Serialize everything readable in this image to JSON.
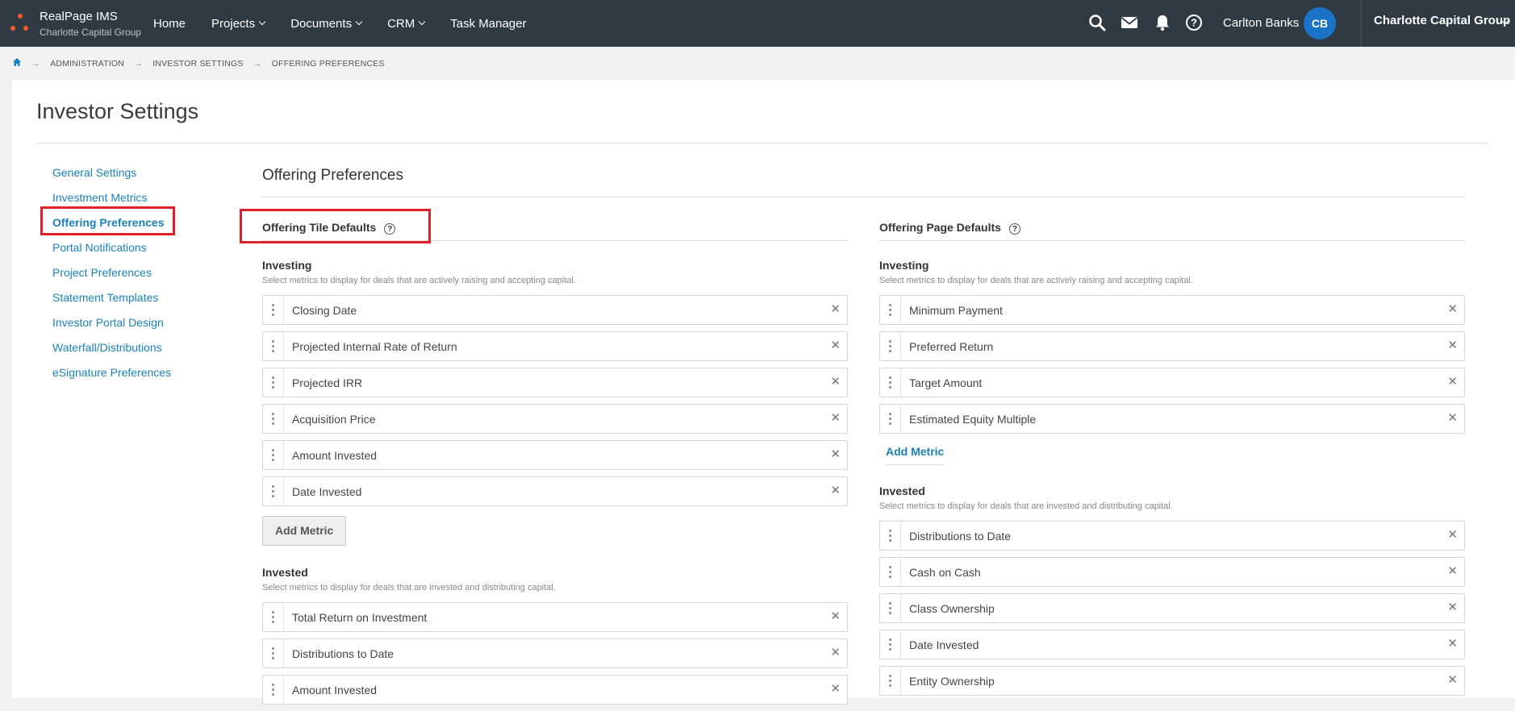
{
  "header": {
    "app_title": "RealPage IMS",
    "app_subtitle": "Charlotte Capital Group",
    "nav": [
      {
        "label": "Home",
        "dropdown": false
      },
      {
        "label": "Projects",
        "dropdown": true
      },
      {
        "label": "Documents",
        "dropdown": true
      },
      {
        "label": "CRM",
        "dropdown": true
      },
      {
        "label": "Task Manager",
        "dropdown": false
      }
    ],
    "icons": [
      "search-icon",
      "mail-icon",
      "bell-icon",
      "help-icon"
    ],
    "user_name": "Carlton Banks",
    "user_initials": "CB",
    "org_name": "Charlotte Capital Group"
  },
  "breadcrumb": [
    "ADMINISTRATION",
    "INVESTOR SETTINGS",
    "OFFERING PREFERENCES"
  ],
  "page_title": "Investor Settings",
  "sidenav": [
    "General Settings",
    "Investment Metrics",
    "Offering Preferences",
    "Portal Notifications",
    "Project Preferences",
    "Statement Templates",
    "Investor Portal Design",
    "Waterfall/Distributions",
    "eSignature Preferences"
  ],
  "section_title": "Offering Preferences",
  "tile_defaults": {
    "title": "Offering Tile Defaults",
    "investing": {
      "title": "Investing",
      "desc": "Select metrics to display for deals that are actively raising and accepting capital.",
      "metrics": [
        "Closing Date",
        "Projected Internal Rate of Return",
        "Projected IRR",
        "Acquisition Price",
        "Amount Invested",
        "Date Invested"
      ],
      "add_label": "Add Metric"
    },
    "invested": {
      "title": "Invested",
      "desc": "Select metrics to display for deals that are invested and distributing capital.",
      "metrics": [
        "Total Return on Investment",
        "Distributions to Date",
        "Amount Invested"
      ]
    }
  },
  "page_defaults": {
    "title": "Offering Page Defaults",
    "investing": {
      "title": "Investing",
      "desc": "Select metrics to display for deals that are actively raising and accepting capital.",
      "metrics": [
        "Minimum Payment",
        "Preferred Return",
        "Target Amount",
        "Estimated Equity Multiple"
      ],
      "add_label": "Add Metric"
    },
    "invested": {
      "title": "Invested",
      "desc": "Select metrics to display for deals that are invested and distributing capital.",
      "metrics": [
        "Distributions to Date",
        "Cash on Cash",
        "Class Ownership",
        "Date Invested",
        "Entity Ownership"
      ]
    }
  },
  "colors": {
    "topbar": "#2f3a43",
    "link": "#1b82b9",
    "highlight": "#e0202a",
    "avatar": "#1a73c6",
    "logo": "#f15a29"
  }
}
